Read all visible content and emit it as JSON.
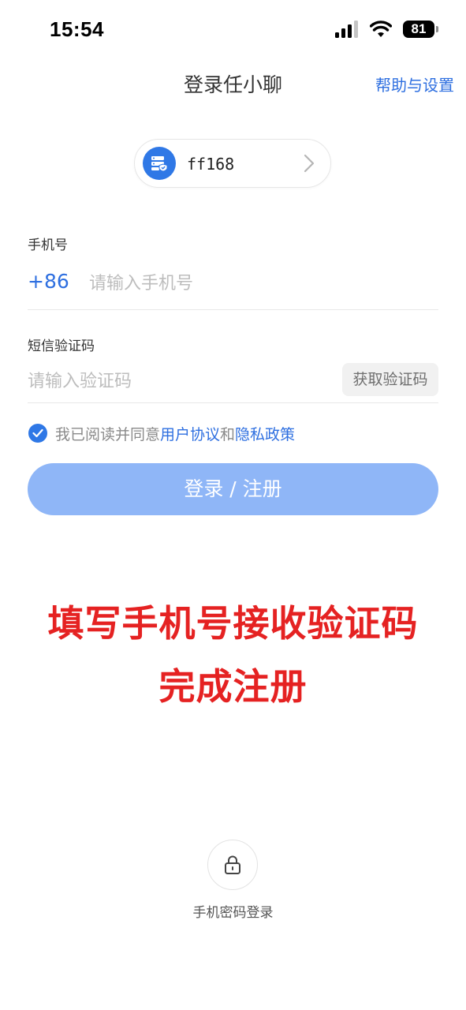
{
  "status_bar": {
    "time": "15:54",
    "battery": "81"
  },
  "header": {
    "title": "登录任小聊",
    "help_link": "帮助与设置"
  },
  "server": {
    "name": "ff168"
  },
  "phone": {
    "label": "手机号",
    "country_code": "+86",
    "placeholder": "请输入手机号"
  },
  "sms": {
    "label": "短信验证码",
    "placeholder": "请输入验证码",
    "get_code_label": "获取验证码"
  },
  "agreement": {
    "checked": true,
    "prefix": "我已阅读并同意",
    "user_agreement": "用户协议",
    "conjunction": "和",
    "privacy_policy": "隐私政策"
  },
  "login_button": {
    "label": "登录 / 注册"
  },
  "annotation": {
    "line1": "填写手机号接收验证码",
    "line2": "完成注册"
  },
  "alt_login": {
    "label": "手机密码登录"
  },
  "colors": {
    "accent": "#2e6fe0",
    "button_disabled": "#8fb6f7",
    "annotation_red": "#e52222"
  }
}
